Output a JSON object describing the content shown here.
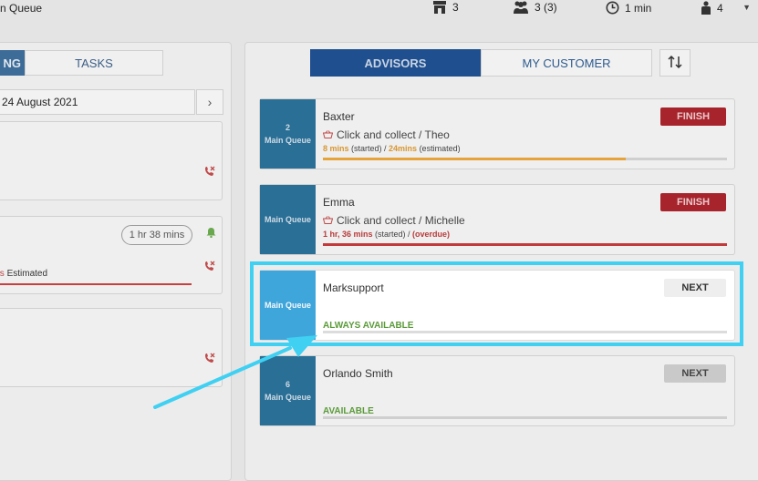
{
  "topbar": {
    "title": "n Queue",
    "stats": [
      {
        "icon": "store-icon",
        "value": "3"
      },
      {
        "icon": "group-icon",
        "value": "3 (3)"
      },
      {
        "icon": "clock-icon",
        "value": "1 min"
      },
      {
        "icon": "person-icon",
        "value": "4"
      }
    ]
  },
  "left": {
    "tabs": [
      "NG",
      "TASKS"
    ],
    "date": "24 August 2021",
    "duration": "1 hr 38 mins",
    "estimated_prefix": "ins",
    "estimated_suffix": " Estimated"
  },
  "right": {
    "tabs": {
      "advisors": "ADVISORS",
      "my_customer": "MY CUSTOMER"
    },
    "cards": [
      {
        "queue_num": "2",
        "queue_label": "Main Queue",
        "name": "Baxter",
        "action": "Click and collect / Theo",
        "sub": {
          "started": "8 mins",
          "started_label": " (started) / ",
          "other": "24mins",
          "other_label": " (estimated)"
        },
        "button": "FINISH",
        "progress": 0.75
      },
      {
        "queue_num": "",
        "queue_label": "Main Queue",
        "name": "Emma",
        "action": "Click and collect / Michelle",
        "sub": {
          "started": "1 hr, 36 mins",
          "started_label": " (started) / ",
          "other": "(overdue)",
          "other_label": ""
        },
        "button": "FINISH",
        "progress": 1.0
      },
      {
        "queue_num": "",
        "queue_label": "Main Queue",
        "name": "Marksupport",
        "status": "ALWAYS AVAILABLE",
        "button": "NEXT",
        "progress": 0
      },
      {
        "queue_num": "6",
        "queue_label": "Main Queue",
        "name": "Orlando Smith",
        "status": "AVAILABLE",
        "button": "NEXT",
        "progress": 0
      }
    ]
  },
  "colors": {
    "accent_blue": "#1f4f8e",
    "queue_blue": "#2a6f96",
    "highlight_cyan": "#3fd0f2",
    "finish_red": "#a8242c",
    "available_green": "#5b9a3a",
    "progress_orange": "#e5a33a",
    "overdue_red": "#c23a3a"
  }
}
